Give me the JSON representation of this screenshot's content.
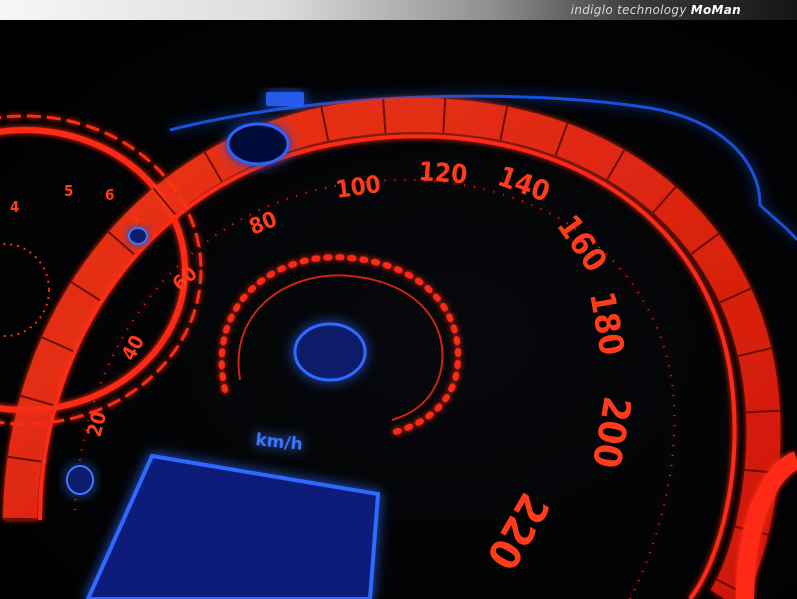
{
  "watermark": {
    "text": "indiglo technology",
    "brand": "MoMan"
  },
  "speedometer": {
    "labels": [
      "20",
      "40",
      "60",
      "80",
      "100",
      "120",
      "140",
      "160",
      "180",
      "200",
      "220"
    ],
    "unit": "km/h"
  },
  "tachometer": {
    "labels": [
      "4",
      "5",
      "6",
      "7"
    ]
  },
  "colors": {
    "dial_red": "#ff2a12",
    "dial_dark_red": "#c81505",
    "backlight_blue": "#1f5fff",
    "background": "#000000"
  }
}
